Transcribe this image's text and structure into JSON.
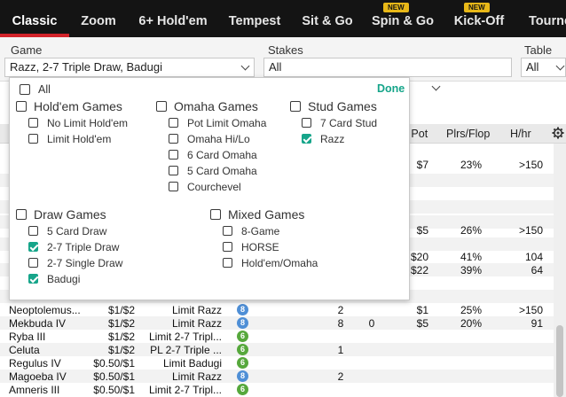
{
  "tabs": [
    {
      "label": "Classic",
      "active": true
    },
    {
      "label": "Zoom"
    },
    {
      "label": "6+ Hold'em"
    },
    {
      "label": "Tempest"
    },
    {
      "label": "Sit & Go"
    },
    {
      "label": "Spin & Go",
      "badge": "NEW"
    },
    {
      "label": "Kick-Off",
      "badge": "NEW"
    },
    {
      "label": "Tourne"
    }
  ],
  "filters": {
    "game": {
      "label": "Game",
      "value": "Razz, 2-7 Triple Draw, Badugi"
    },
    "stakes": {
      "label": "Stakes",
      "value": "All"
    },
    "table_size": {
      "label": "Table Siz",
      "value": "All"
    }
  },
  "table": {
    "headers": {
      "avg_pot": "g Pot",
      "plrs_flop": "Plrs/Flop",
      "hhr": "H/hr"
    },
    "rows": [
      {
        "avg_pot": "$7",
        "plrs_flop": "23%",
        "hhr": ">150"
      },
      {
        "avg_pot": "$5",
        "plrs_flop": "26%",
        "hhr": ">150"
      },
      {
        "avg_pot": "$20",
        "plrs_flop": "41%",
        "hhr": "104"
      },
      {
        "avg_pot": "$22",
        "plrs_flop": "39%",
        "hhr": "64"
      },
      {
        "name": "Neoptolemus...",
        "stakes": "$1/$2",
        "game": "Limit Razz",
        "seats": "8",
        "seat_color": "#4f8fd6",
        "players": "2",
        "wait": "",
        "avg_pot": "$1",
        "plrs_flop": "25%",
        "hhr": ">150"
      },
      {
        "name": "Mekbuda IV",
        "stakes": "$1/$2",
        "game": "Limit Razz",
        "seats": "8",
        "seat_color": "#4f8fd6",
        "players": "8",
        "wait": "0",
        "avg_pot": "$5",
        "plrs_flop": "20%",
        "hhr": "91"
      },
      {
        "name": "Ryba III",
        "stakes": "$1/$2",
        "game": "Limit 2-7 Tripl...",
        "seats": "6",
        "seat_color": "#56a83c",
        "players": "",
        "wait": "",
        "avg_pot": "",
        "plrs_flop": "",
        "hhr": ""
      },
      {
        "name": "Celuta",
        "stakes": "$1/$2",
        "game": "PL 2-7 Triple ...",
        "seats": "6",
        "seat_color": "#56a83c",
        "players": "1",
        "wait": "",
        "avg_pot": "",
        "plrs_flop": "",
        "hhr": ""
      },
      {
        "name": "Regulus IV",
        "stakes": "$0.50/$1",
        "game": "Limit Badugi",
        "seats": "6",
        "seat_color": "#56a83c",
        "players": "",
        "wait": "",
        "avg_pot": "",
        "plrs_flop": "",
        "hhr": ""
      },
      {
        "name": "Magoeba IV",
        "stakes": "$0.50/$1",
        "game": "Limit Razz",
        "seats": "8",
        "seat_color": "#4f8fd6",
        "players": "2",
        "wait": "",
        "avg_pot": "",
        "plrs_flop": "",
        "hhr": ""
      },
      {
        "name": "Amneris III",
        "stakes": "$0.50/$1",
        "game": "Limit 2-7 Tripl...",
        "seats": "6",
        "seat_color": "#56a83c",
        "players": "",
        "wait": "",
        "avg_pot": "",
        "plrs_flop": "",
        "hhr": ""
      }
    ]
  },
  "dropdown": {
    "done_label": "Done",
    "all": {
      "label": "All",
      "checked": false
    },
    "holdem": {
      "label": "Hold'em Games",
      "checked": false,
      "items": [
        {
          "label": "No Limit Hold'em",
          "checked": false
        },
        {
          "label": "Limit Hold'em",
          "checked": false
        }
      ]
    },
    "omaha": {
      "label": "Omaha Games",
      "checked": false,
      "items": [
        {
          "label": "Pot Limit Omaha",
          "checked": false
        },
        {
          "label": "Omaha Hi/Lo",
          "checked": false
        },
        {
          "label": "6 Card Omaha",
          "checked": false
        },
        {
          "label": "5 Card Omaha",
          "checked": false
        },
        {
          "label": "Courchevel",
          "checked": false
        }
      ]
    },
    "stud": {
      "label": "Stud Games",
      "checked": false,
      "items": [
        {
          "label": "7 Card Stud",
          "checked": false
        },
        {
          "label": "Razz",
          "checked": true
        }
      ]
    },
    "draw": {
      "label": "Draw Games",
      "checked": false,
      "items": [
        {
          "label": "5 Card Draw",
          "checked": false
        },
        {
          "label": "2-7 Triple Draw",
          "checked": true
        },
        {
          "label": "2-7 Single Draw",
          "checked": false
        },
        {
          "label": "Badugi",
          "checked": true
        }
      ]
    },
    "mixed": {
      "label": "Mixed Games",
      "checked": false,
      "items": [
        {
          "label": "8-Game",
          "checked": false
        },
        {
          "label": "HORSE",
          "checked": false
        },
        {
          "label": "Hold'em/Omaha",
          "checked": false
        }
      ]
    }
  },
  "colors": {
    "accent_red": "#d2232a",
    "check_green": "#16a58a",
    "badge_yellow": "#e8b818"
  }
}
